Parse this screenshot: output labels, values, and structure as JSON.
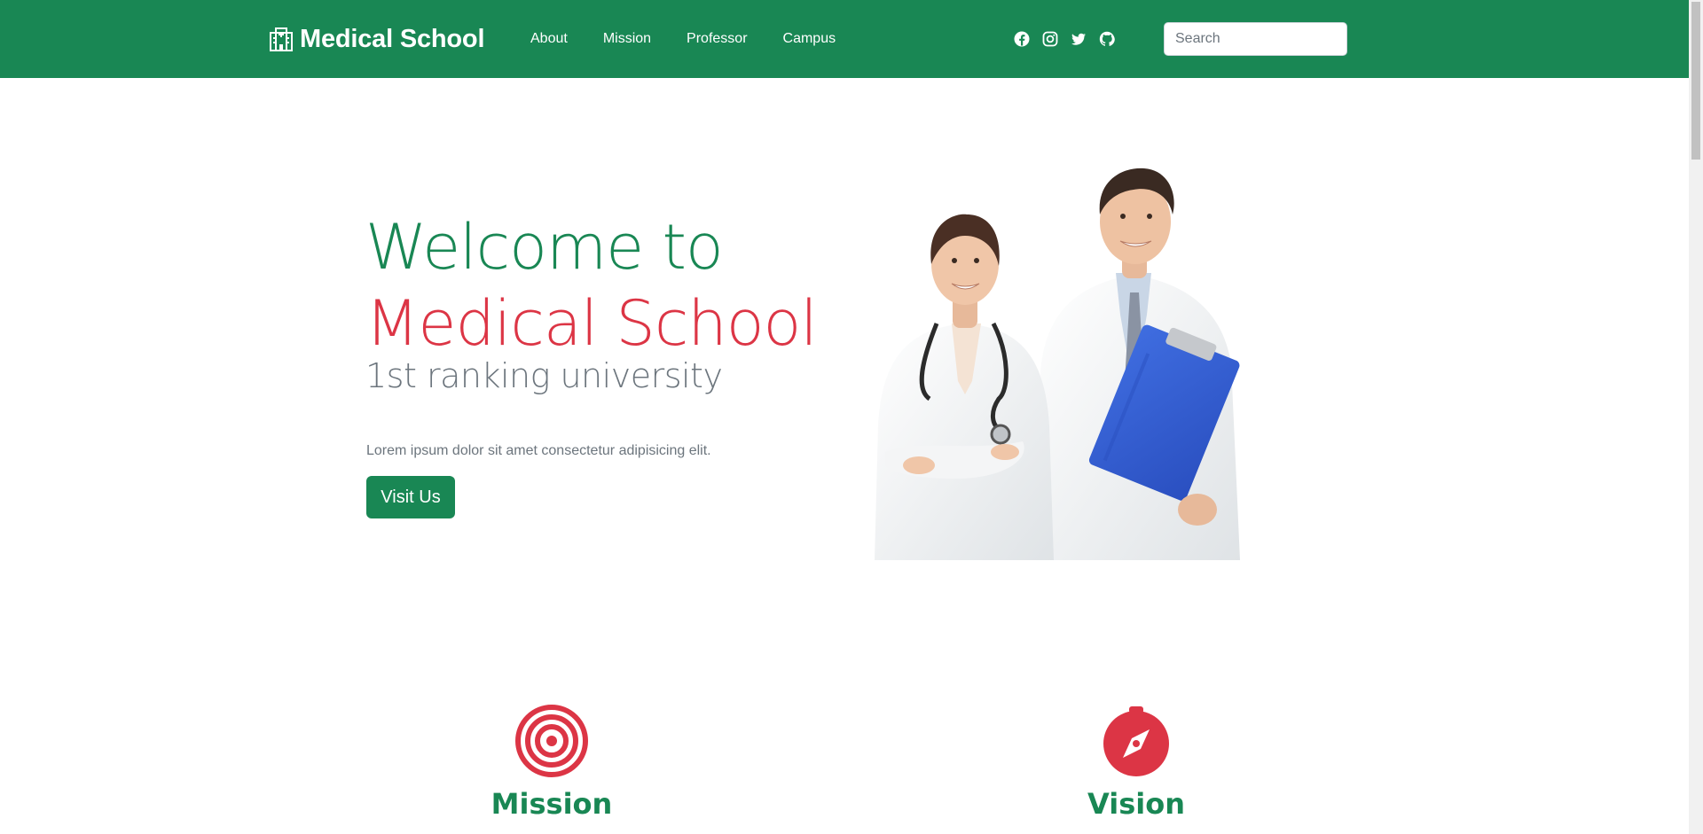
{
  "navbar": {
    "brand": "Medical School",
    "brand_icon": "hospital-icon",
    "links": [
      {
        "label": "About"
      },
      {
        "label": "Mission"
      },
      {
        "label": "Professor"
      },
      {
        "label": "Campus"
      }
    ],
    "socials": [
      "facebook-icon",
      "instagram-icon",
      "twitter-icon",
      "github-icon"
    ],
    "search_placeholder": "Search"
  },
  "hero": {
    "title_line1": "Welcome to",
    "title_line2": "Medical School",
    "subtitle": "1st ranking university",
    "lead": "Lorem ipsum dolor sit amet consectetur adipisicing elit.",
    "button_label": "Visit Us"
  },
  "features": {
    "mission": {
      "title": "Mission",
      "icon": "target-icon"
    },
    "vision": {
      "title": "Vision",
      "icon": "compass-icon"
    }
  },
  "colors": {
    "primary": "#198754",
    "accent": "#dc3545",
    "muted": "#6c757d"
  }
}
